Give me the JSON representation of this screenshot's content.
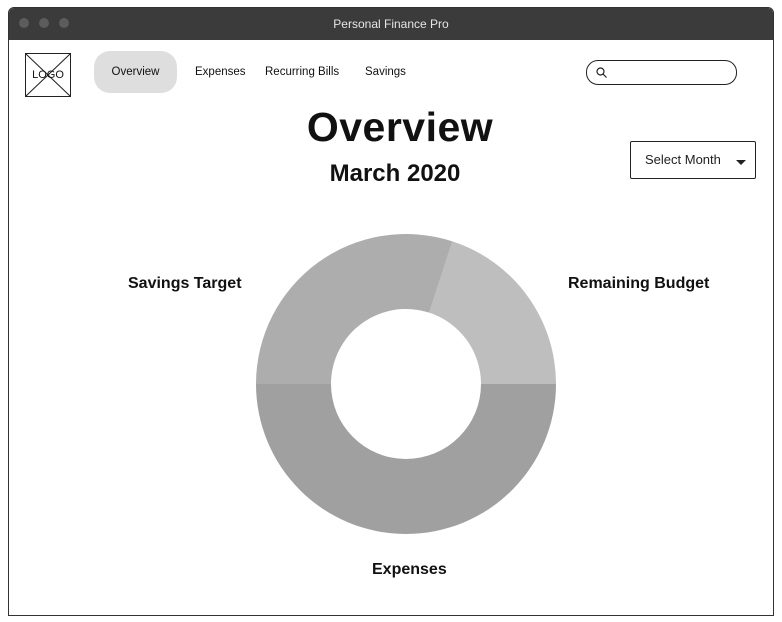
{
  "window": {
    "title": "Personal Finance Pro"
  },
  "logo": {
    "label": "LOGO"
  },
  "nav": {
    "items": [
      {
        "label": "Overview",
        "active": true
      },
      {
        "label": "Expenses",
        "active": false
      },
      {
        "label": "Recurring Bills",
        "active": false
      },
      {
        "label": "Savings",
        "active": false
      }
    ]
  },
  "search": {
    "value": "",
    "placeholder": "",
    "icon": "search-icon"
  },
  "main": {
    "title": "Overview",
    "subtitle": "March 2020",
    "month_select": {
      "label": "Select Month",
      "icon": "chevron-down-icon"
    }
  },
  "chart_data": {
    "type": "pie",
    "donut": true,
    "slices": [
      {
        "label": "Remaining Budget",
        "value": 20,
        "color": "#bebebe"
      },
      {
        "label": "Expenses",
        "value": 50,
        "color": "#a0a0a0"
      },
      {
        "label": "Savings Target",
        "value": 30,
        "color": "#adadad"
      }
    ]
  },
  "colors": {
    "titlebar": "#3b3b3b",
    "nav_active": "#dedede"
  }
}
